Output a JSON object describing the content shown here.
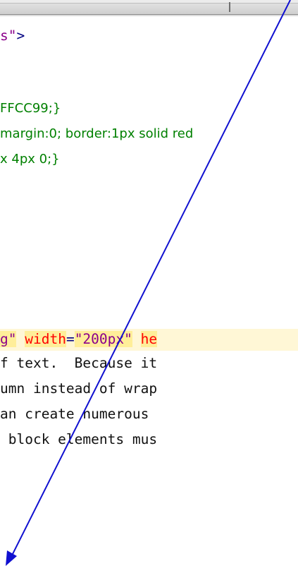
{
  "code_lines": {
    "l1_value": "s\"",
    "l1_close": ">",
    "css1": "FFCC99;}",
    "css2": "margin:0; border:1px solid red",
    "css3": "x 4px 0;}",
    "img_quote": "g\"",
    "img_width_attr": "width",
    "img_eq1": "=",
    "img_width_val": "\"200px\"",
    "img_space": " ",
    "img_height_attr": "he",
    "text1": "f text.  Because it",
    "text2": "umn instead of wrap",
    "text3": "an create numerous",
    "text4": " block elements mus"
  },
  "annotation": {
    "color": "#1010d0",
    "shape": "arrow"
  }
}
